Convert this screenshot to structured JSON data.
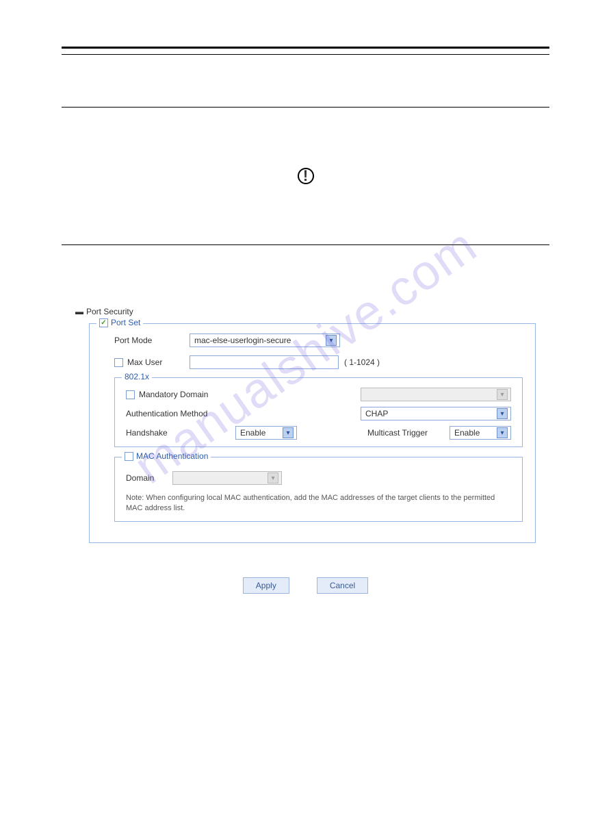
{
  "watermark": "manualshive.com",
  "icons": {
    "warning_glyph": "!"
  },
  "portSecurity": {
    "title": "Port Security",
    "panel": {
      "legend": "Port Set",
      "portSetChecked": "✓",
      "portModeLabel": "Port Mode",
      "portModeValue": "mac-else-userlogin-secure",
      "maxUserLabel": "Max User",
      "maxUserValue": "",
      "maxUserRange": "( 1-1024 )"
    },
    "dot1x": {
      "legend": "802.1x",
      "mandatoryDomainLabel": "Mandatory Domain",
      "mandatoryDomainValue": "",
      "authMethodLabel": "Authentication Method",
      "authMethodValue": "CHAP",
      "handshakeLabel": "Handshake",
      "handshakeValue": "Enable",
      "multicastTriggerLabel": "Multicast Trigger",
      "multicastTriggerValue": "Enable"
    },
    "macAuth": {
      "legend": "MAC Authentication",
      "domainLabel": "Domain",
      "domainValue": "",
      "note": "Note: When configuring local MAC authentication, add the MAC addresses of the target clients to the permitted MAC address list."
    }
  },
  "buttons": {
    "apply": "Apply",
    "cancel": "Cancel"
  }
}
